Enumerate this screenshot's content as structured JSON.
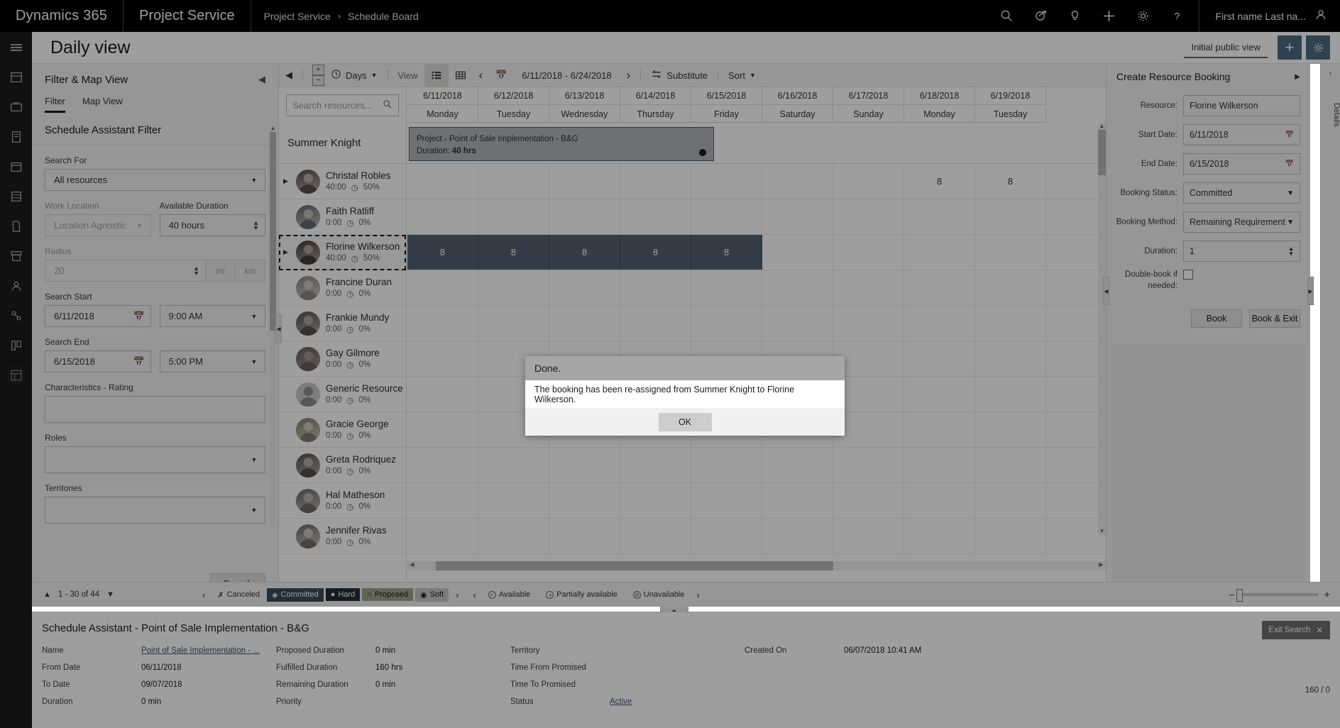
{
  "topnav": {
    "brand": "Dynamics 365",
    "app": "Project Service",
    "breadcrumb": [
      "Project Service",
      "Schedule Board"
    ],
    "breadcrumb_sep": "›",
    "icons": [
      "search-icon",
      "target-icon",
      "lightbulb-icon",
      "plus-icon",
      "gear-icon",
      "help-icon"
    ],
    "user": "First name Last na..."
  },
  "pageheader": {
    "title": "Daily view",
    "view_tab": "Initial public view",
    "add_label": "+",
    "settings_label": "⚙"
  },
  "filterpanel": {
    "title": "Filter & Map View",
    "collapse": "◀",
    "tabs": [
      {
        "label": "Filter",
        "active": true
      },
      {
        "label": "Map View",
        "active": false
      }
    ],
    "section_title": "Schedule Assistant Filter",
    "fields": {
      "search_for_label": "Search For",
      "search_for_value": "All resources",
      "work_location_label": "Work Location",
      "work_location_value": "Location Agnostic",
      "available_duration_label": "Available Duration",
      "available_duration_value": "40 hours",
      "radius_label": "Radius",
      "radius_value": "20",
      "radius_unit_mi": "mi",
      "radius_unit_km": "km",
      "search_start_label": "Search Start",
      "search_start_date": "6/11/2018",
      "search_start_time": "9:00 AM",
      "search_end_label": "Search End",
      "search_end_date": "6/15/2018",
      "search_end_time": "5:00 PM",
      "characteristics_label": "Characteristics - Rating",
      "characteristics_value": "",
      "roles_label": "Roles",
      "roles_value": "",
      "territories_label": "Territories",
      "territories_value": ""
    },
    "search_button": "Search"
  },
  "boardtoolbar": {
    "zoom_in": "+",
    "zoom_out": "−",
    "clock_icon": "clock-icon",
    "days_label": "Days",
    "caret": "▼",
    "view_label": "View",
    "list_icon": "list-view-icon",
    "grid_icon": "grid-view-icon",
    "prev": "‹",
    "calendar_icon": "calendar-icon",
    "daterange": "6/11/2018 - 6/24/2018",
    "next": "›",
    "substitute": "Substitute",
    "sort": "Sort",
    "right_icons": [
      "eye-icon",
      "gear-icon",
      "refresh-icon",
      "fullscreen-icon"
    ]
  },
  "resources": {
    "search_placeholder": "Search resources...",
    "group_name": "Summer Knight",
    "items": [
      {
        "name": "Christal Robles",
        "hours": "40:00",
        "pct": "50%",
        "expandable": true,
        "selected": false,
        "generic": false
      },
      {
        "name": "Faith Ratliff",
        "hours": "0:00",
        "pct": "0%",
        "expandable": false,
        "selected": false,
        "generic": false
      },
      {
        "name": "Florine Wilkerson",
        "hours": "40:00",
        "pct": "50%",
        "expandable": true,
        "selected": true,
        "generic": false
      },
      {
        "name": "Francine Duran",
        "hours": "0:00",
        "pct": "0%",
        "expandable": false,
        "selected": false,
        "generic": false
      },
      {
        "name": "Frankie Mundy",
        "hours": "0:00",
        "pct": "0%",
        "expandable": false,
        "selected": false,
        "generic": false
      },
      {
        "name": "Gay Gilmore",
        "hours": "0:00",
        "pct": "0%",
        "expandable": false,
        "selected": false,
        "generic": false
      },
      {
        "name": "Generic Resource",
        "hours": "0:00",
        "pct": "0%",
        "expandable": false,
        "selected": false,
        "generic": true
      },
      {
        "name": "Gracie George",
        "hours": "0:00",
        "pct": "0%",
        "expandable": false,
        "selected": false,
        "generic": false
      },
      {
        "name": "Greta Rodriquez",
        "hours": "0:00",
        "pct": "0%",
        "expandable": false,
        "selected": false,
        "generic": false
      },
      {
        "name": "Hal Matheson",
        "hours": "0:00",
        "pct": "0%",
        "expandable": false,
        "selected": false,
        "generic": false
      },
      {
        "name": "Jennifer Rivas",
        "hours": "0:00",
        "pct": "0%",
        "expandable": false,
        "selected": false,
        "generic": false
      }
    ]
  },
  "timeline": {
    "columns": [
      {
        "date": "6/11/2018",
        "day": "Monday"
      },
      {
        "date": "6/12/2018",
        "day": "Tuesday"
      },
      {
        "date": "6/13/2018",
        "day": "Wednesday"
      },
      {
        "date": "6/14/2018",
        "day": "Thursday"
      },
      {
        "date": "6/15/2018",
        "day": "Friday"
      },
      {
        "date": "6/16/2018",
        "day": "Saturday"
      },
      {
        "date": "6/17/2018",
        "day": "Sunday"
      },
      {
        "date": "6/18/2018",
        "day": "Monday"
      },
      {
        "date": "6/19/2018",
        "day": "Tuesday"
      }
    ],
    "group_booking": {
      "line1": "Project - Point of Sale Implementation - B&G",
      "line2_label": "Duration:",
      "line2_value": "40 hrs"
    },
    "christal_cells": [
      "",
      "",
      "",
      "",
      "",
      "",
      "",
      "8",
      "8"
    ],
    "florine_cells": [
      "8",
      "8",
      "8",
      "8",
      "8",
      "",
      "",
      "",
      ""
    ]
  },
  "legendbar": {
    "pager": "1 - 30 of 44",
    "up": "▲",
    "down": "▼",
    "left": "‹",
    "right": "›",
    "status_chips": [
      {
        "label": "Canceled",
        "glyph": "✗",
        "style": "canceled"
      },
      {
        "label": "Committed",
        "glyph": "◈",
        "style": "committed"
      },
      {
        "label": "Hard",
        "glyph": "●",
        "style": "hard"
      },
      {
        "label": "Proposed",
        "glyph": "○",
        "style": "proposed"
      },
      {
        "label": "Soft",
        "glyph": "◉",
        "style": "soft"
      }
    ],
    "availability_chips": [
      {
        "label": "Available",
        "glyph": "✓"
      },
      {
        "label": "Partially available",
        "glyph": "◑"
      },
      {
        "label": "Unavailable",
        "glyph": "⊘"
      }
    ],
    "zoom_minus": "−",
    "zoom_plus": "+"
  },
  "detailstab": {
    "label": "Details",
    "chevron": "‹"
  },
  "bottompane": {
    "title": "Schedule Assistant - Point of Sale Implementation - B&G",
    "exit_label": "Exit Search",
    "exit_icon": "close-icon",
    "col1": [
      {
        "k": "Name",
        "v": "Point of Sale Implementation - ...",
        "link": true
      },
      {
        "k": "From Date",
        "v": "06/11/2018",
        "link": false
      },
      {
        "k": "To Date",
        "v": "09/07/2018",
        "link": false
      },
      {
        "k": "Duration",
        "v": "0 min",
        "link": false
      }
    ],
    "col2": [
      {
        "k": "Proposed Duration",
        "v": "0 min",
        "link": false
      },
      {
        "k": "Fulfilled Duration",
        "v": "160 hrs",
        "link": false
      },
      {
        "k": "Remaining Duration",
        "v": "0 min",
        "link": false
      },
      {
        "k": "Priority",
        "v": "",
        "link": false
      }
    ],
    "col3": [
      {
        "k": "Territory",
        "v": "",
        "link": false
      },
      {
        "k": "Time From Promised",
        "v": "",
        "link": false
      },
      {
        "k": "Time To Promised",
        "v": "",
        "link": false
      },
      {
        "k": "Status",
        "v": "Active",
        "link": true
      }
    ],
    "col4": [
      {
        "k": "Created On",
        "v": "06/07/2018 10:41 AM",
        "link": false
      }
    ],
    "ratio": "160 / 0"
  },
  "bookingpanel": {
    "title": "Create Resource Booking",
    "expand": "▶",
    "fields": [
      {
        "label": "Resource:",
        "value": "Florine Wilkerson",
        "type": "text"
      },
      {
        "label": "Start Date:",
        "value": "6/11/2018",
        "type": "date"
      },
      {
        "label": "End Date:",
        "value": "6/15/2018",
        "type": "date"
      },
      {
        "label": "Booking Status:",
        "value": "Committed",
        "type": "select"
      },
      {
        "label": "Booking Method:",
        "value": "Remaining Requirement",
        "type": "select"
      },
      {
        "label": "Duration:",
        "value": "1",
        "type": "spinner"
      }
    ],
    "doublebook_label": "Double-book if needed:",
    "buttons": [
      "Book",
      "Book & Exit"
    ]
  },
  "modal": {
    "title": "Done.",
    "message": "The booking has been re-assigned from Summer Knight to Florine Wilkerson.",
    "ok": "OK"
  },
  "colors": {
    "accent": "#0078d4",
    "committed": "#12538f",
    "hard": "#0e2f52",
    "proposed": "#8eb13c",
    "soft": "#c9c9c9",
    "booking_block": "#2a6aa8",
    "link": "#1155cc"
  }
}
